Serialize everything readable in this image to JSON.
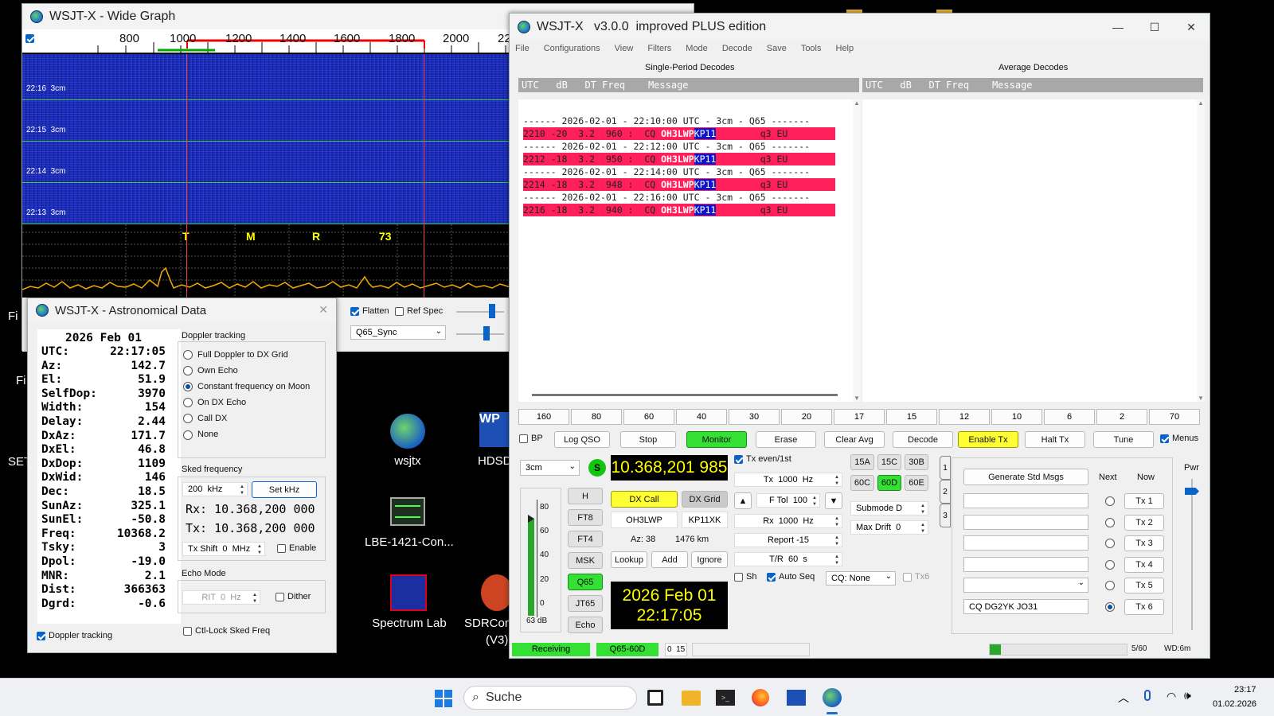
{
  "wide_graph": {
    "title": "WSJT-X - Wide Graph",
    "freq_ticks": [
      "800",
      "1000",
      "1200",
      "1400",
      "1600",
      "1800",
      "2000",
      "22"
    ],
    "time_labels": [
      "22:16  3cm",
      "22:15  3cm",
      "22:14  3cm",
      "22:13  3cm"
    ],
    "markers": [
      "T",
      "M",
      "R",
      "73"
    ],
    "flatten_label": "Flatten",
    "refspec_label": "Ref Spec",
    "mode_select": "Q65_Sync",
    "flatten_checked": true,
    "refspec_checked": false
  },
  "main": {
    "title": "WSJT-X   v3.0.0  improved PLUS edition",
    "menu": [
      "File",
      "Configurations",
      "View",
      "Filters",
      "Mode",
      "Decode",
      "Save",
      "Tools",
      "Help"
    ],
    "single_period_title": "Single-Period Decodes",
    "average_title": "Average Decodes",
    "columns_header": "UTC   dB   DT Freq    Message",
    "decodes": [
      {
        "type": "sep",
        "text": "------ 2026-02-01 - 22:10:00 UTC - 3cm - Q65 -------"
      },
      {
        "type": "hit",
        "pre": "2210 -20  3.2  960 :  CQ ",
        "call": "OH3LWP",
        "grid": "KP11",
        "post": "        q3 EU"
      },
      {
        "type": "sep",
        "text": "------ 2026-02-01 - 22:12:00 UTC - 3cm - Q65 -------"
      },
      {
        "type": "hit",
        "pre": "2212 -18  3.2  950 :  CQ ",
        "call": "OH3LWP",
        "grid": "KP11",
        "post": "        q3 EU"
      },
      {
        "type": "sep",
        "text": "------ 2026-02-01 - 22:14:00 UTC - 3cm - Q65 -------"
      },
      {
        "type": "hit",
        "pre": "2214 -18  3.2  948 :  CQ ",
        "call": "OH3LWP",
        "grid": "KP11",
        "post": "        q3 EU"
      },
      {
        "type": "sep",
        "text": "------ 2026-02-01 - 22:16:00 UTC - 3cm - Q65 -------"
      },
      {
        "type": "hit",
        "pre": "2216 -18  3.2  940 :  CQ ",
        "call": "OH3LWP",
        "grid": "KP11",
        "post": "        q3 EU"
      }
    ],
    "bands": [
      "160",
      "80",
      "60",
      "40",
      "30",
      "20",
      "17",
      "15",
      "12",
      "10",
      "6",
      "2",
      "70"
    ],
    "buttons": {
      "bp": "BP",
      "log_qso": "Log QSO",
      "stop": "Stop",
      "monitor": "Monitor",
      "erase": "Erase",
      "clear_avg": "Clear Avg",
      "decode": "Decode",
      "enable_tx": "Enable Tx",
      "halt_tx": "Halt Tx",
      "tune": "Tune",
      "menus": "Menus"
    },
    "band_select": "3cm",
    "s_badge": "S",
    "dial_freq": "10.368,201 985",
    "modes": [
      "H",
      "FT8",
      "FT4",
      "MSK",
      "Q65",
      "JT65",
      "Echo"
    ],
    "meter_ticks": [
      "80",
      "60",
      "40",
      "20",
      "0"
    ],
    "meter_db": "63 dB",
    "dx_call_btn": "DX Call",
    "dx_grid_btn": "DX Grid",
    "dx_call": "OH3LWP",
    "dx_grid": "KP11XK",
    "az": "Az: 38",
    "dist": "1476 km",
    "lookup": "Lookup",
    "add": "Add",
    "ignore": "Ignore",
    "clock_date": "2026 Feb 01",
    "clock_time": "22:17:05",
    "tx_even": "Tx even/1st",
    "tx_freq": "Tx  1000  Hz",
    "ftol": "F Tol  100",
    "rx_freq": "Rx  1000  Hz",
    "report": "Report -15",
    "tr": "T/R  60  s",
    "submodes": [
      "15A",
      "15C",
      "30B",
      "60C",
      "60D",
      "60E"
    ],
    "submode": "Submode D",
    "max_drift": "Max Drift  0",
    "sh": "Sh",
    "auto_seq": "Auto Seq",
    "cq_none": "CQ: None",
    "tx6_chk": "Tx6",
    "gen_std": "Generate Std Msgs",
    "next": "Next",
    "now": "Now",
    "tx_buttons": [
      "Tx 1",
      "Tx 2",
      "Tx 3",
      "Tx 4",
      "Tx 5",
      "Tx 6"
    ],
    "tx6_msg": "CQ DG2YK JO31",
    "pwr": "Pwr",
    "tabs": [
      "1",
      "2",
      "3"
    ],
    "status": {
      "receiving": "Receiving",
      "mode": "Q65-60D",
      "count": "0  15",
      "progress": "5/60",
      "wd": "WD:6m"
    }
  },
  "astro": {
    "title": "WSJT-X - Astronomical Data",
    "date": "2026 Feb 01",
    "rows": [
      [
        "UTC:",
        "22:17:05"
      ],
      [
        "Az:",
        "142.7"
      ],
      [
        "El:",
        "51.9"
      ],
      [
        "SelfDop:",
        "3970"
      ],
      [
        "Width:",
        "154"
      ],
      [
        "Delay:",
        "2.44"
      ],
      [
        "DxAz:",
        "171.7"
      ],
      [
        "DxEl:",
        "46.8"
      ],
      [
        "DxDop:",
        "1109"
      ],
      [
        "DxWid:",
        "146"
      ],
      [
        "Dec:",
        "18.5"
      ],
      [
        "SunAz:",
        "325.1"
      ],
      [
        "SunEl:",
        "-50.8"
      ],
      [
        "Freq:",
        "10368.2"
      ],
      [
        "Tsky:",
        "3"
      ],
      [
        "Dpol:",
        "-19.0"
      ],
      [
        "MNR:",
        "2.1"
      ],
      [
        "Dist:",
        "366363"
      ],
      [
        "Dgrd:",
        "-0.6"
      ]
    ],
    "doppler_title": "Doppler tracking",
    "doppler_opts": [
      "Full Doppler to DX Grid",
      "Own Echo",
      "Constant frequency on Moon",
      "On DX Echo",
      "Call DX",
      "None"
    ],
    "sked_title": "Sked frequency",
    "sked_val": "200  kHz",
    "set_khz": "Set kHz",
    "rx": "Rx: 10.368,200 000",
    "tx": "Tx: 10.368,200 000",
    "tx_shift": "Tx Shift  0  MHz",
    "enable": "Enable",
    "echo_title": "Echo Mode",
    "rit": "RIT  0  Hz",
    "dither": "Dither",
    "doppler_chk": "Doppler tracking",
    "ctl_lock": "Ctl-Lock Sked Freq"
  },
  "desktop": {
    "icons": [
      "wsjtx",
      "HDSD",
      "LBE-1421-Con...",
      "Spectrum Lab",
      "SDRCon",
      "(V3)"
    ],
    "edge_labels": [
      "Fi",
      "Fi",
      "SET"
    ]
  },
  "taskbar": {
    "search": "Suche",
    "time": "23:17",
    "date": "01.02.2026"
  },
  "colors": {
    "waterfall": "#1a2bb0",
    "decode_hit": "#ff1f5a",
    "grid_hl": "#0d17c9",
    "monitor": "#33e033",
    "enable_tx": "#ffff33"
  }
}
